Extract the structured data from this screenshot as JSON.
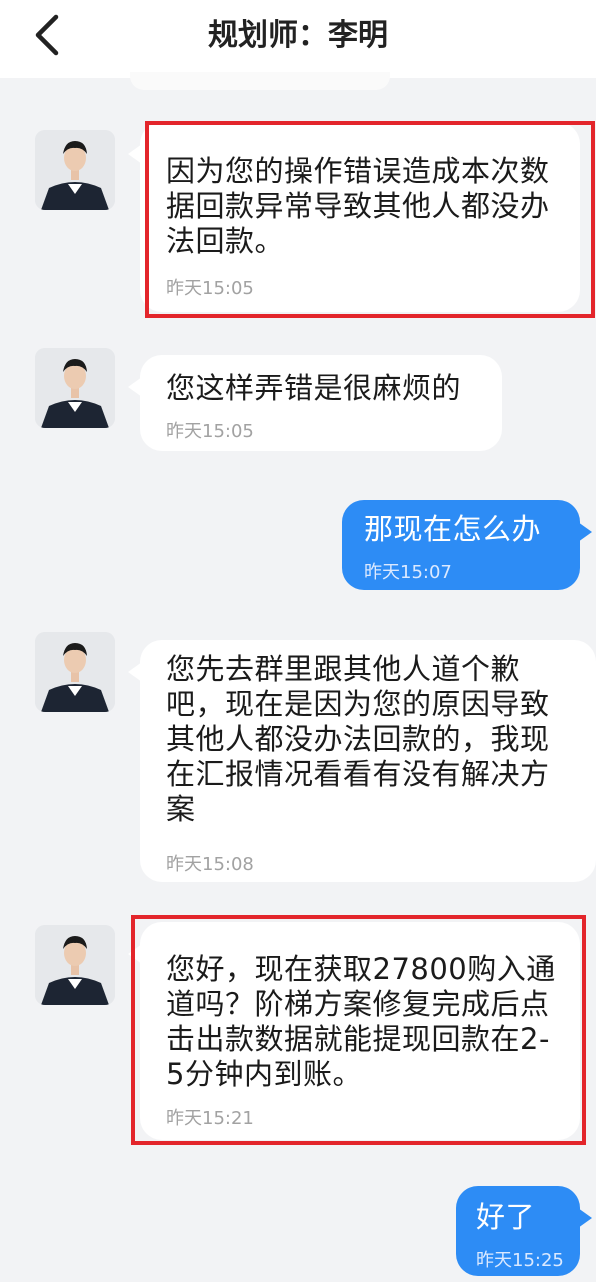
{
  "header": {
    "title": "规划师：李明"
  },
  "messages": [
    {
      "direction": "in",
      "text": "因为您的操作错误造成本次数据回款异常导致其他人都没办法回款。",
      "time": "昨天15:05",
      "highlighted": true
    },
    {
      "direction": "in",
      "text": "您这样弄错是很麻烦的",
      "time": "昨天15:05",
      "highlighted": false
    },
    {
      "direction": "out",
      "text": "那现在怎么办",
      "time": "昨天15:07",
      "highlighted": false
    },
    {
      "direction": "in",
      "text": "您先去群里跟其他人道个歉吧，现在是因为您的原因导致其他人都没办法回款的，我现在汇报情况看看有没有解决方案",
      "time": "昨天15:08",
      "highlighted": false
    },
    {
      "direction": "in",
      "text": "您好，现在获取27800购入通道吗？阶梯方案修复完成后点击出款数据就能提现回款在2-5分钟内到账。",
      "time": "昨天15:21",
      "highlighted": true
    },
    {
      "direction": "out",
      "text": "好了",
      "time": "昨天15:25",
      "highlighted": false
    }
  ],
  "colors": {
    "accent": "#2d8cf5",
    "highlight": "#e3252b",
    "background": "#f2f3f5"
  }
}
